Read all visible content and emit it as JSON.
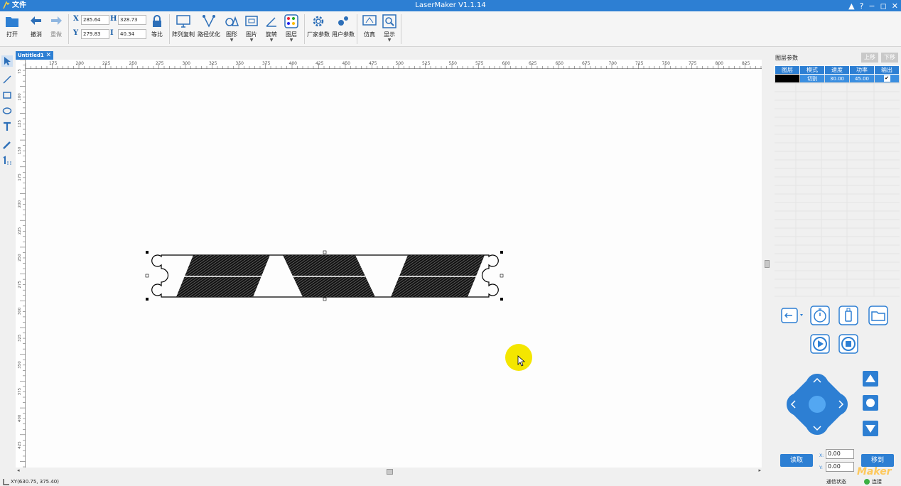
{
  "titlebar": {
    "file_menu": "文件",
    "title": "LaserMaker V1.1.14",
    "controls": [
      "▲",
      "?",
      "−",
      "◻",
      "✕"
    ]
  },
  "toolbar": {
    "open": "打开",
    "undo": "撤消",
    "redo": "重做",
    "x_label": "X",
    "y_label": "Y",
    "x_value": "285.64",
    "y_value": "279.83",
    "h_label": "H",
    "w_label": "I",
    "h_value": "328.73",
    "w_value": "40.34",
    "lock_ratio": "等比",
    "array_copy": "阵列复制",
    "path_optimize": "路径优化",
    "shape": "图形",
    "image": "图片",
    "rotate": "旋转",
    "layer": "图层",
    "vendor_params": "厂家参数",
    "user_params": "用户参数",
    "simulate": "仿真",
    "display": "显示"
  },
  "document": {
    "tab_name": "Untitled1",
    "tab_close": "✕"
  },
  "ruler": {
    "top_ticks": [
      "175",
      "200",
      "225",
      "250",
      "275",
      "300",
      "325",
      "350",
      "375",
      "400",
      "425",
      "450",
      "475",
      "500",
      "525",
      "550",
      "575",
      "600",
      "625",
      "650",
      "675",
      "700",
      "725",
      "750",
      "775",
      "800",
      "825",
      "850"
    ],
    "left_ticks": [
      "75",
      "100",
      "125",
      "150",
      "175",
      "200",
      "225",
      "250",
      "275",
      "300",
      "325",
      "350",
      "375",
      "400",
      "425",
      "450",
      "475"
    ]
  },
  "layer_panel": {
    "title": "图层参数",
    "move_up": "上移",
    "move_down": "下移",
    "columns": [
      "图层",
      "模式",
      "速度",
      "功率",
      "输出"
    ],
    "rows": [
      {
        "mode": "切割",
        "speed": "30.00",
        "power": "45.00",
        "output": "✔"
      }
    ]
  },
  "control_panel": {
    "x_label": "X:",
    "y_label": "Y:",
    "x_value": "0.00",
    "y_value": "0.00",
    "read_button": "读取",
    "move_button": "移到",
    "watermark": "Maker"
  },
  "statusbar": {
    "coords": "XY(630.75, 375.40)",
    "comm_status": "通信状态",
    "connection": "连接"
  },
  "colors": {
    "accent": "#2d7fd3",
    "status_ok": "#3cb043",
    "cursor_highlight": "#f4e600"
  }
}
